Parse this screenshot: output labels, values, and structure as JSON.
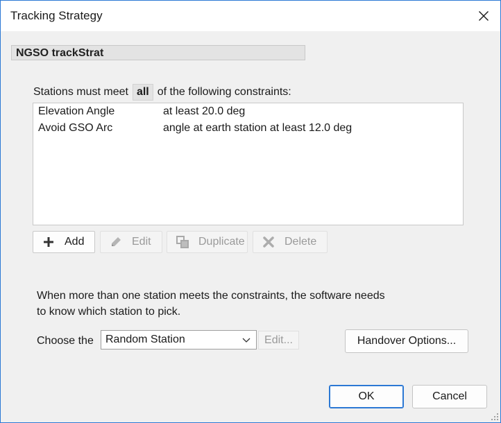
{
  "window": {
    "title": "Tracking Strategy",
    "close_icon": "close-icon"
  },
  "strategy": {
    "name": "NGSO trackStrat"
  },
  "constraints_header": {
    "prefix": "Stations must meet",
    "mode": "all",
    "suffix": "of the following constraints:"
  },
  "constraints": [
    {
      "name": "Elevation Angle",
      "description": "at least 20.0 deg"
    },
    {
      "name": "Avoid GSO Arc",
      "description": "angle at earth station at least 12.0 deg"
    }
  ],
  "toolbar": {
    "add_label": "Add",
    "edit_label": "Edit",
    "duplicate_label": "Duplicate",
    "delete_label": "Delete"
  },
  "selection": {
    "paragraph_line1": "When more than one station meets the constraints, the software needs",
    "paragraph_line2": "to know which station to pick.",
    "choose_label": "Choose the",
    "selected_option": "Random Station",
    "edit_label": "Edit...",
    "handover_label": "Handover Options..."
  },
  "footer": {
    "ok_label": "OK",
    "cancel_label": "Cancel"
  },
  "colors": {
    "accent": "#2b78d4",
    "dialog_bg": "#f0f0f0",
    "disabled_text": "#9a9a9a"
  }
}
